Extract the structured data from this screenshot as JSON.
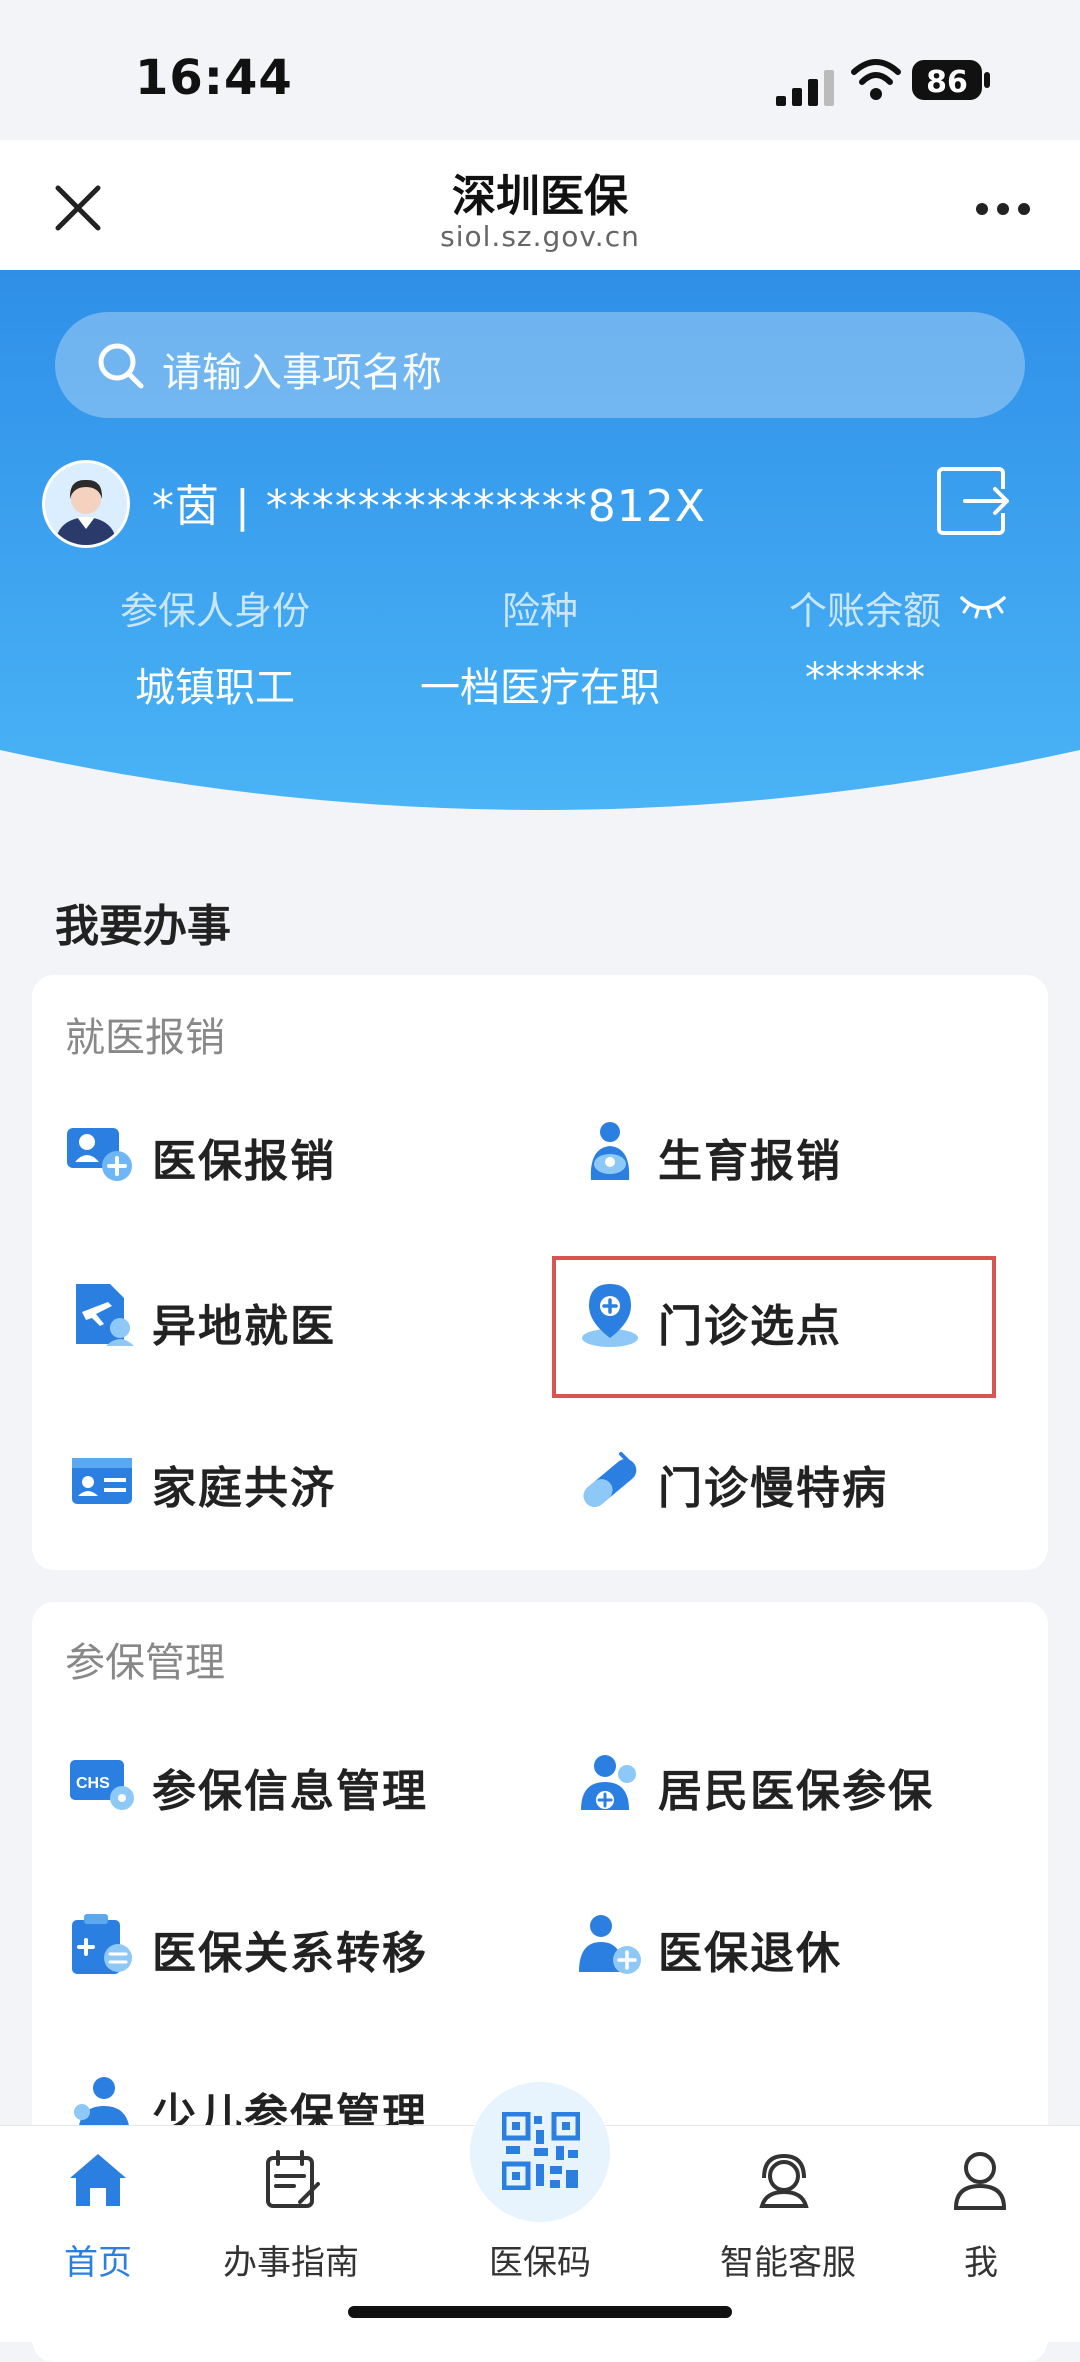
{
  "status": {
    "time": "16:44",
    "battery": "86"
  },
  "header": {
    "title": "深圳医保",
    "subtitle": "siol.sz.gov.cn"
  },
  "search": {
    "placeholder": "请输入事项名称"
  },
  "user": {
    "name_id": "*茵 | **************812X",
    "labels": [
      "参保人身份",
      "险种",
      "个账余额"
    ],
    "values": [
      "城镇职工",
      "一档医疗在职",
      "******"
    ]
  },
  "section_title": "我要办事",
  "card1": {
    "title": "就医报销",
    "items": [
      "医保报销",
      "生育报销",
      "异地就医",
      "门诊选点",
      "家庭共济",
      "门诊慢特病"
    ]
  },
  "card2": {
    "title": "参保管理",
    "items": [
      "参保信息管理",
      "居民医保参保",
      "医保关系转移",
      "医保退休",
      "少儿参保管理"
    ]
  },
  "tabbar": {
    "tabs": [
      "首页",
      "办事指南",
      "医保码",
      "智能客服",
      "我"
    ]
  },
  "colors": {
    "primary": "#2b8ae6",
    "banner_top": "#2f8fe8",
    "banner_bottom": "#48b2f5",
    "highlight": "#d9534f"
  }
}
